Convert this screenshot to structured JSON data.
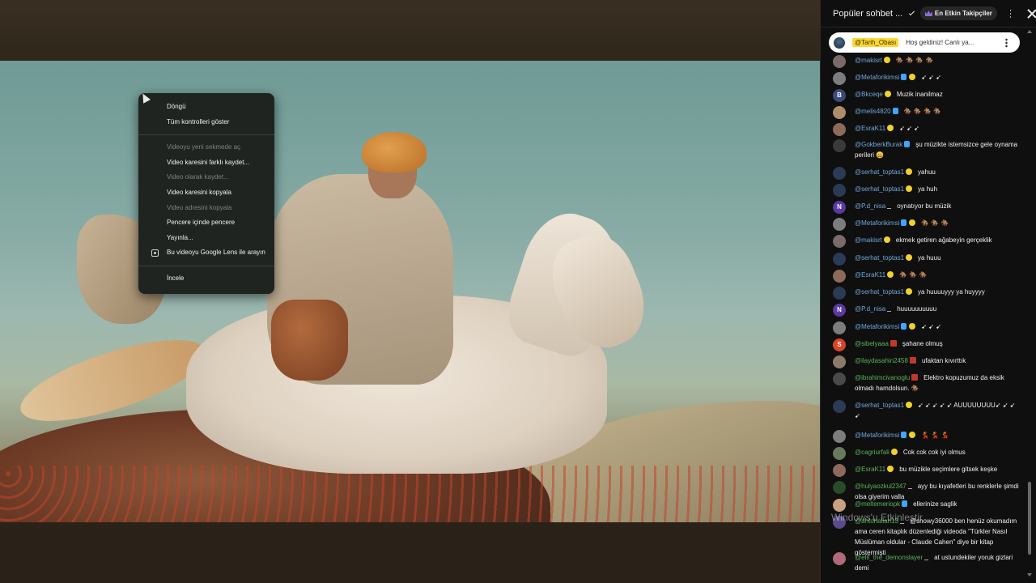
{
  "context_menu": {
    "items": [
      {
        "label": "Döngü",
        "disabled": false
      },
      {
        "label": "Tüm kontrolleri göster",
        "disabled": false
      },
      {
        "label": "Videoyu yeni sekmede aç",
        "disabled": true
      },
      {
        "label": "Video karesini farklı kaydet...",
        "disabled": false
      },
      {
        "label": "Video olarak kaydet...",
        "disabled": true
      },
      {
        "label": "Video karesini kopyala",
        "disabled": false
      },
      {
        "label": "Video adresini kopyala",
        "disabled": true
      },
      {
        "label": "Pencere içinde pencere",
        "disabled": false
      },
      {
        "label": "Yayınla...",
        "disabled": false
      },
      {
        "label": "Bu videoyu Google Lens ile arayın",
        "disabled": false,
        "icon": "google-lens-icon"
      },
      {
        "label": "İncele",
        "disabled": false
      }
    ]
  },
  "chat": {
    "header": {
      "title": "Popüler sohbet ...",
      "top_fans_label": "En Etkin Takipçiler"
    },
    "pinned": {
      "author": "@Tarih_Obası",
      "text": "Hoş geldiniz! Canlı ya..."
    },
    "messages": [
      {
        "author": "@makisrt",
        "badge": "gold",
        "text": "🏇 🏇 🏇 🏇",
        "avatar_color": "#7a6a6a",
        "green": false
      },
      {
        "author": "@Metaforikimsi",
        "badge": "mod-gold",
        "text": "➹ ➹ ➹",
        "avatar_color": "#7d7d7d",
        "green": false
      },
      {
        "author": "@Bkceqe",
        "badge": "gold",
        "text": "Muzik inanilmaz",
        "avatar_color": "#3b4a78",
        "avatar_letter": "B",
        "green": false
      },
      {
        "author": "@melis4820",
        "badge": "mod",
        "text": "🏇 🏇 🏇 🏇",
        "avatar_color": "#b08d6a",
        "green": false
      },
      {
        "author": "@EsraK11",
        "badge": "gold",
        "text": "➹ ➹ ➹",
        "avatar_color": "#8d6a5a",
        "green": false
      },
      {
        "author": "@GokberkBurak",
        "badge": "mod",
        "text": "şu müzikte istemsizce gele oynama perileri 😄",
        "avatar_color": "#3a3a3a",
        "green": false
      },
      {
        "author": "@serhat_toptas1",
        "badge": "gold",
        "text": "yahuu",
        "avatar_color": "#2b3a55",
        "green": false
      },
      {
        "author": "@serhat_toptas1",
        "badge": "gold",
        "text": "ya huh",
        "avatar_color": "#2b3a55",
        "green": false
      },
      {
        "author": "@P.d_nisa",
        "badge": "arrow",
        "text": "oynatıyor bu müzik",
        "avatar_color": "#5a3aa0",
        "avatar_letter": "N",
        "green": false
      },
      {
        "author": "@Metaforikimsi",
        "badge": "mod-gold",
        "text": "🏇 🏇 🏇",
        "avatar_color": "#7d7d7d",
        "green": false
      },
      {
        "author": "@makisrt",
        "badge": "gold",
        "text": "ekmek getiren ağabeyin gerçeklik",
        "avatar_color": "#7a6a6a",
        "green": false
      },
      {
        "author": "@serhat_toptas1",
        "badge": "gold",
        "text": "ya huuu",
        "avatar_color": "#2b3a55",
        "green": false
      },
      {
        "author": "@EsraK11",
        "badge": "gold",
        "text": "🏇 🏇 🏇",
        "avatar_color": "#8d6a5a",
        "green": false
      },
      {
        "author": "@serhat_toptas1",
        "badge": "gold",
        "text": "ya huuuuyyy ya huyyyy",
        "avatar_color": "#2b3a55",
        "green": false
      },
      {
        "author": "@P.d_nisa",
        "badge": "arrow",
        "text": "huuuuuuuuuu",
        "avatar_color": "#5a3aa0",
        "avatar_letter": "N",
        "green": false
      },
      {
        "author": "@Metaforikimsi",
        "badge": "mod-gold",
        "text": "➹ ➹ ➹",
        "avatar_color": "#7d7d7d",
        "green": false
      },
      {
        "author": "@sibelyaaa",
        "badge": "bull",
        "text": "şahane olmuş",
        "avatar_color": "#d9432b",
        "avatar_letter": "S",
        "green": true
      },
      {
        "author": "@ilaydasahin2458",
        "badge": "bull",
        "text": "ufaktan kıvırttık",
        "avatar_color": "#8a7a6a",
        "green": true
      },
      {
        "author": "@ibrahimcivanoglu",
        "badge": "bull",
        "text": "Elektro kopuzumuz da eksik olmadı hamdolsun. 🏇",
        "avatar_color": "#4a4a4a",
        "green": true
      },
      {
        "author": "@serhat_toptas1",
        "badge": "gold",
        "text": "➹ ➹ ➹ ➹ ➹ AUUUUUUUU➹ ➹ ➹ ➹",
        "avatar_color": "#2b3a55",
        "green": false
      },
      {
        "author": "@Metaforikimsi",
        "badge": "mod-gold",
        "text": "💃 💃 💃",
        "avatar_color": "#7d7d7d",
        "green": false
      },
      {
        "author": "@cagriurfali",
        "badge": "gold",
        "text": "Cok cok cok iyi olmus",
        "avatar_color": "#6a7a5a",
        "green": true
      },
      {
        "author": "@EsraK11",
        "badge": "gold",
        "text": "bu müzikle seçimlere gitsek keşke",
        "avatar_color": "#8d6a5a",
        "green": true
      },
      {
        "author": "@hulyaozkul2347",
        "badge": "arrow",
        "text": "ayy bu kıyafetleri bu renklerle şimdi olsa giyerim valla",
        "avatar_color": "#2a4a2a",
        "green": true
      },
      {
        "author": "@meltemeriopk",
        "badge": "mod",
        "text": "ellerinize saglik",
        "avatar_color": "#c9a080",
        "green": true
      },
      {
        "author": "@ahtohallan13",
        "badge": "arrow",
        "text": "@snowy36000 ben henüz okumadım ama ceren kitaplık düzenlediği videoda \"Türkler Nasıl Müslüman oldular - Claude Cahen\" diye bir kitap göstermişti",
        "avatar_color": "#5a4a8a",
        "green": true
      },
      {
        "author": "@elif_the_demonslayer",
        "badge": "arrow",
        "text": "at ustundekiler yoruk gizlari demi",
        "avatar_color": "#b06a7a",
        "green": true
      }
    ]
  },
  "watermark": "Windows'u Etkinleştir"
}
